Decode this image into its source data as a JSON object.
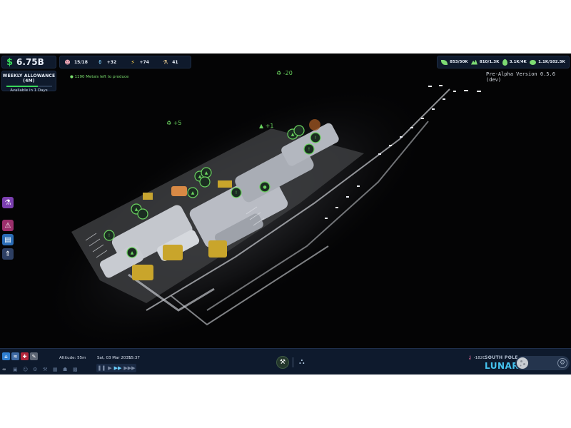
{
  "hud": {
    "money": "6.75B",
    "money_symbol": "$",
    "allowance_title": "WEEKLY ALLOWANCE (4M)",
    "allowance_subtitle": "Available in 1 Days",
    "allowance_progress": 0.7,
    "stats": [
      {
        "icon": "people-icon",
        "value": "15/18"
      },
      {
        "icon": "bottle-icon",
        "value": "+32"
      },
      {
        "icon": "lightning-icon",
        "value": "+74"
      },
      {
        "icon": "flask-icon",
        "value": "41"
      }
    ],
    "resources": [
      {
        "icon": "leaf-icon",
        "value": "853/50K"
      },
      {
        "icon": "rock-icon",
        "value": "810/1.3K"
      },
      {
        "icon": "droplet-icon",
        "value": "3.1K/4K"
      },
      {
        "icon": "metal-icon",
        "value": "1.1K/102.5K"
      }
    ],
    "task": "1190 Metals left to produce",
    "version": "Pre-Alpha Version 0.5.6 (dev)"
  },
  "floating_numbers": [
    {
      "text": "-20"
    },
    {
      "text": "+5"
    },
    {
      "text": "+1"
    }
  ],
  "bottom_bar": {
    "altitude": "Altitude: 55m",
    "date": "Sat, 03 Mar 2035",
    "time": "15:37",
    "temperature": "-182C",
    "region": "SOUTH POLE",
    "location": "LUNAR"
  },
  "colors": {
    "accent_green": "#39d65a",
    "panel_bg": "#0f1a2c",
    "lunar_blue": "#45c3ef"
  }
}
